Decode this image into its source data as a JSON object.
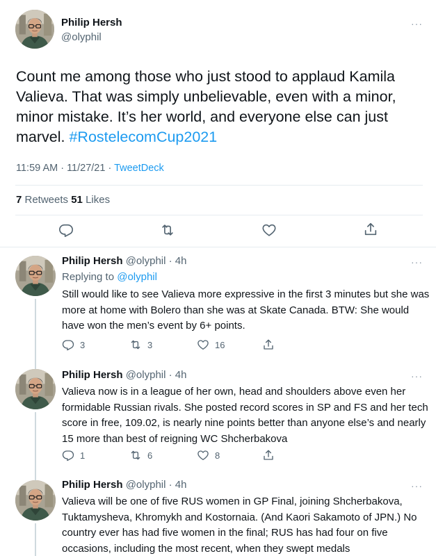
{
  "main_tweet": {
    "author_name": "Philip Hersh",
    "author_handle": "@olyphil",
    "text_before_hashtag": "Count me among those who just stood to applaud Kamila Valieva.  That was simply unbelievable, even with a minor, minor mistake.  It’s her world, and everyone else can just marvel.  ",
    "hashtag": "#RostelecomCup2021",
    "time": "11:59 AM · 11/27/21 · ",
    "source": "TweetDeck",
    "retweets_count": "7",
    "retweets_label": " Retweets  ",
    "likes_count": "51",
    "likes_label": " Likes",
    "more_glyph": "···"
  },
  "replies": [
    {
      "author_name": "Philip Hersh",
      "author_handle": " @olyphil · 4h",
      "replying_label": "Replying to ",
      "replying_to": "@olyphil",
      "text": "Still would like to see Valieva more expressive in the first 3 minutes but she was more at home with Bolero than she was at Skate Canada.  BTW: She would have won the men’s event by 6+ points.",
      "reply_count": "3",
      "retweet_count": "3",
      "like_count": "16"
    },
    {
      "author_name": "Philip Hersh",
      "author_handle": " @olyphil · 4h",
      "text": "Valieva now is in a league of her own, head and shoulders above even her formidable Russian rivals.  She posted record scores in SP and FS and her tech score in free, 109.02, is nearly nine points better than anyone else’s and nearly 15 more than best of reigning WC Shcherbakova",
      "reply_count": "1",
      "retweet_count": "6",
      "like_count": "8"
    },
    {
      "author_name": "Philip Hersh",
      "author_handle": " @olyphil · 4h",
      "text": "Valieva will be one of five RUS women in GP Final, joining Shcherbakova, Tuktamysheva, Khromykh and Kostornaia.  (And Kaori Sakamoto of JPN.) No country ever has had five women in the final; RUS has had four on five occasions, including the most recent, when they swept medals"
    }
  ],
  "colors": {
    "link": "#1d9bf0",
    "secondary_text": "#536471",
    "divider": "#e6ecf0",
    "thread_line": "#cfd9de"
  },
  "icons": [
    "reply-icon",
    "retweet-icon",
    "like-icon",
    "share-icon",
    "more-icon",
    "avatar"
  ]
}
